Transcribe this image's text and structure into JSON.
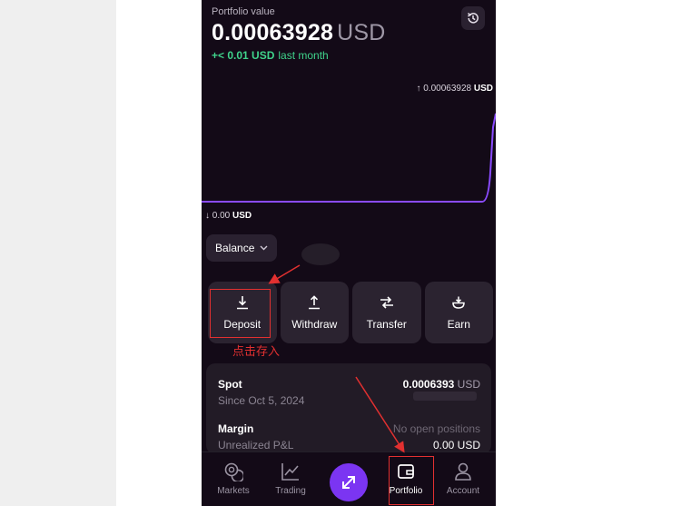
{
  "portfolio": {
    "label": "Portfolio value",
    "value": "0.00063928",
    "unit": "USD",
    "change_amount": "+< 0.01 USD",
    "change_period": "last month"
  },
  "chart": {
    "max_value": "0.00063928",
    "max_unit": "USD",
    "min_value": "0.00",
    "min_unit": "USD",
    "line_color": "#8a4bff"
  },
  "balance": {
    "label": "Balance"
  },
  "actions": [
    {
      "label": "Deposit",
      "icon": "download-icon"
    },
    {
      "label": "Withdraw",
      "icon": "upload-icon"
    },
    {
      "label": "Transfer",
      "icon": "transfer-arrows-icon"
    },
    {
      "label": "Earn",
      "icon": "earn-icon"
    }
  ],
  "annotation": {
    "text": "点击存入",
    "color": "#e23030"
  },
  "spot": {
    "title": "Spot",
    "since": "Since Oct 5, 2024",
    "value": "0.0006393",
    "unit": "USD"
  },
  "margin": {
    "title": "Margin",
    "sub": "Unrealized P&L",
    "status": "No open positions",
    "value": "0.00 USD"
  },
  "nav": [
    {
      "label": "Markets",
      "icon": "markets-icon"
    },
    {
      "label": "Trading",
      "icon": "chart-line-icon"
    },
    {
      "label": "",
      "icon": "swap-icon"
    },
    {
      "label": "Portfolio",
      "icon": "wallet-icon"
    },
    {
      "label": "Account",
      "icon": "user-icon"
    }
  ],
  "colors": {
    "accent": "#7b35f2",
    "positive": "#3fd38b",
    "background": "#130a17"
  }
}
